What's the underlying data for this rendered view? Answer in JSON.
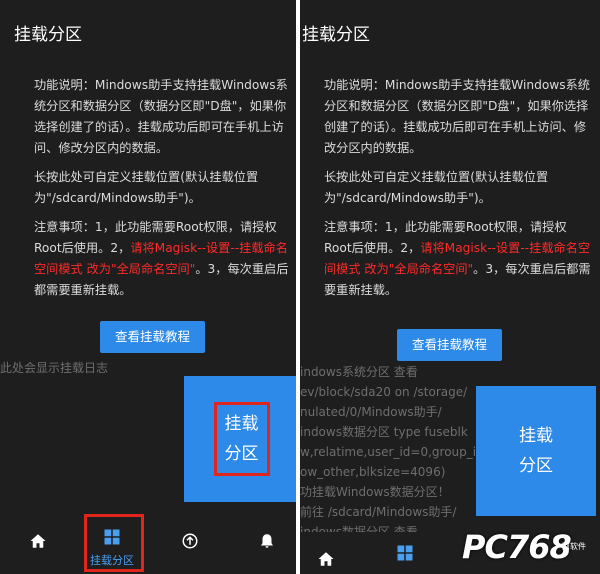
{
  "left": {
    "title": "挂载分区",
    "desc1": "功能说明：Mindows助手支持挂载Windows系统分区和数据分区（数据分区即\"D盘\"，如果你选择创建了的话）。挂载成功后即可在手机上访问、修改分区内的数据。",
    "desc2": "长按此处可自定义挂载位置(默认挂载位置为\"/sdcard/Mindows助手\")。",
    "desc3_a": "注意事项：1，此功能需要Root权限，请授权Root后使用。2，",
    "desc3_red": "请将Magisk--设置--挂载命名空间模式 改为\"全局命名空间\"",
    "desc3_b": "。3，每次重启后都需要重新挂载。",
    "tutorial_button": "查看挂载教程",
    "log_hint": "此处会显示挂载日志",
    "mount_line1": "挂载",
    "mount_line2": "分区",
    "nav_label": "挂载分区"
  },
  "right": {
    "title": "挂载分区",
    "desc1": "功能说明：Mindows助手支持挂载Windows系统分区和数据分区（数据分区即\"D盘\"，如果你选择创建了的话）。挂载成功后即可在手机上访问、修改分区内的数据。",
    "desc2": "长按此处可自定义挂载位置(默认挂载位置为\"/sdcard/Mindows助手\")。",
    "desc3_a": "注意事项：1，此功能需要Root权限，请授权Root后使用。2，",
    "desc3_red": "请将Magisk--设置--挂载命名空间模式 改为\"全局命名空间\"",
    "desc3_b": "。3，每次重启后都需要重新挂载。",
    "tutorial_button": "查看挂载教程",
    "log_lines": [
      "indows系统分区 查看",
      "ev/block/sda20 on /storage/",
      "nulated/0/Mindows助手/",
      "indows数据分区 type fuseblk",
      "w,relatime,user_id=0,group_id=0,",
      "ow_other,blksize=4096)",
      "功挂载Windows数据分区！",
      "前往 /sdcard/Mindows助手/",
      "indows数据分区 查看"
    ],
    "mount_line1": "挂载",
    "mount_line2": "分区"
  },
  "watermark": {
    "text": "PC768",
    "sub": "阿软件"
  }
}
